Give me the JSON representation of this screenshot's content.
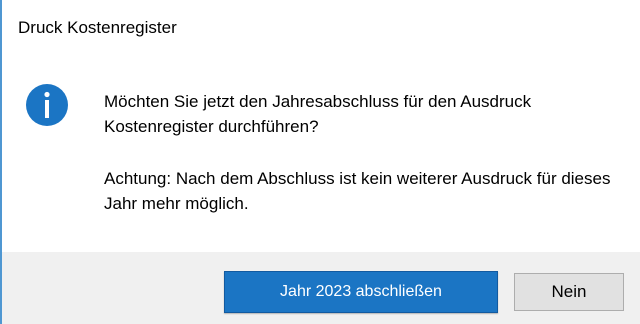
{
  "dialog": {
    "title": "Druck Kostenregister",
    "icon": "info-icon",
    "accent_color": "#1b75c4",
    "message_lines": {
      "question": "Möchten Sie jetzt den Jahresabschluss für den Ausdruck Kostenregister durchführen?",
      "warning": "Achtung: Nach dem Abschluss ist kein weiterer Ausdruck für dieses Jahr mehr möglich."
    },
    "buttons": {
      "confirm_label": "Jahr 2023 abschließen",
      "cancel_label": "Nein"
    }
  }
}
